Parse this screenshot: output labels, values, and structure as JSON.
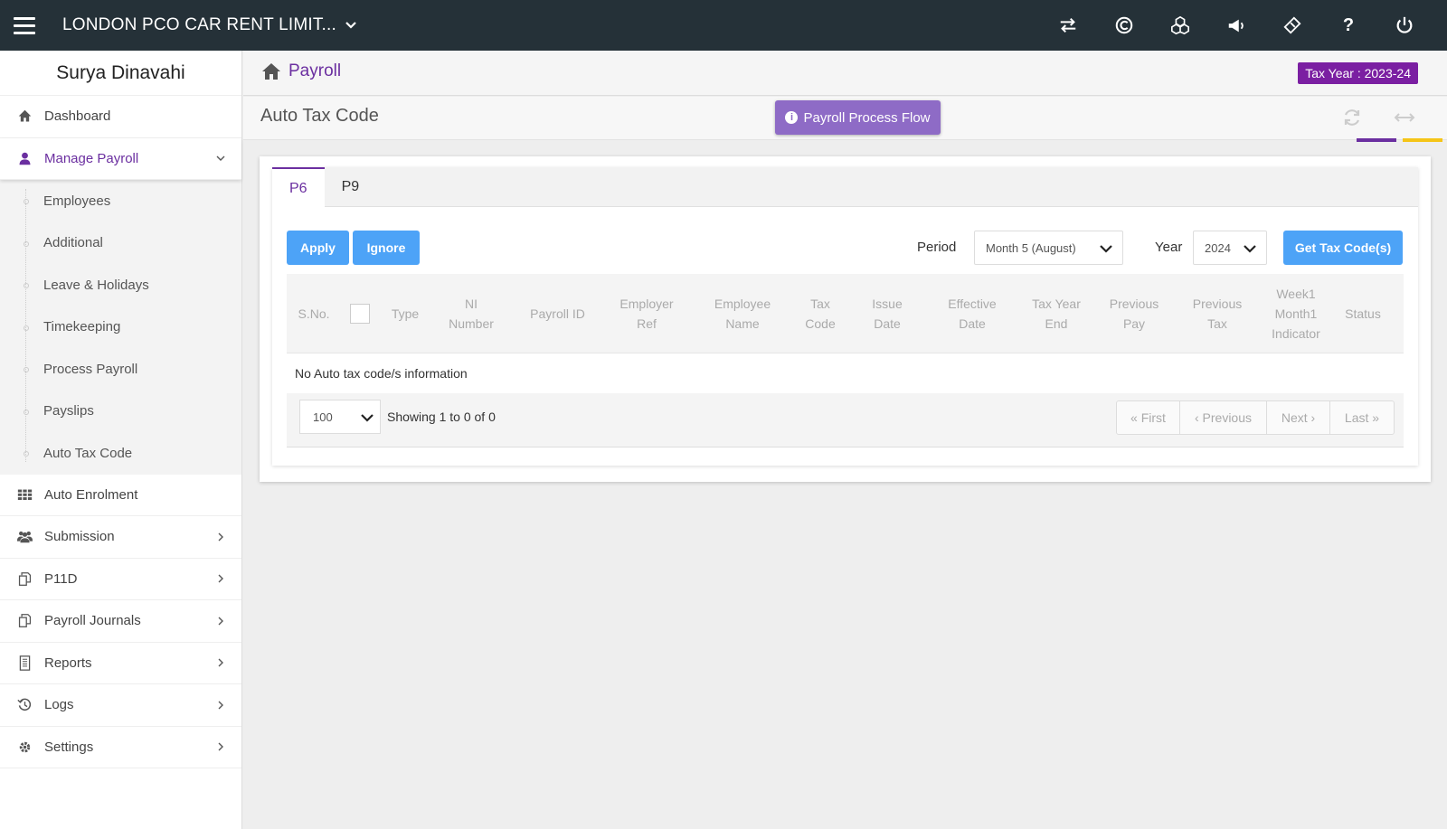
{
  "topbar": {
    "company": "LONDON PCO CAR RENT LIMIT...",
    "help_label": "?"
  },
  "sidebar": {
    "user_name": "Surya Dinavahi",
    "items": [
      {
        "label": "Dashboard",
        "icon": "home-icon"
      },
      {
        "label": "Manage Payroll",
        "icon": "user-icon"
      },
      {
        "label": "Auto Enrolment",
        "icon": "grid-icon"
      },
      {
        "label": "Submission",
        "icon": "users-icon"
      },
      {
        "label": "P11D",
        "icon": "copy-icon"
      },
      {
        "label": "Payroll Journals",
        "icon": "copy-icon"
      },
      {
        "label": "Reports",
        "icon": "document-icon"
      },
      {
        "label": "Logs",
        "icon": "history-icon"
      },
      {
        "label": "Settings",
        "icon": "gear-icon"
      }
    ],
    "submenu": [
      "Employees",
      "Additional",
      "Leave & Holidays",
      "Timekeeping",
      "Process Payroll",
      "Payslips",
      "Auto Tax Code"
    ]
  },
  "header": {
    "breadcrumb": "Payroll",
    "tax_year": "Tax Year : 2023-24"
  },
  "subheader": {
    "title": "Auto Tax Code",
    "flow_button": "Payroll Process Flow"
  },
  "tabs": [
    "P6",
    "P9"
  ],
  "toolbar": {
    "apply": "Apply",
    "ignore": "Ignore",
    "period_label": "Period",
    "period_value": "Month 5 (August)",
    "year_label": "Year",
    "year_value": "2024",
    "get_button": "Get Tax Code(s)"
  },
  "table": {
    "columns": [
      "S.No.",
      "Type",
      "NI\nNumber",
      "Payroll ID",
      "Employer\nRef",
      "Employee\nName",
      "Tax\nCode",
      "Issue\nDate",
      "Effective\nDate",
      "Tax Year\nEnd",
      "Previous\nPay",
      "Previous\nTax",
      "Week1\nMonth1\nIndicator",
      "Status"
    ],
    "empty_message": "No Auto tax code/s information"
  },
  "pager": {
    "page_size": "100",
    "showing": "Showing 1 to 0 of 0",
    "first": "« First",
    "previous": "‹ Previous",
    "next": "Next ›",
    "last": "Last »"
  },
  "colors": {
    "topbar": "#253138",
    "accent_purple": "#6b2fa0",
    "button_blue": "#4da3f7",
    "flow_button": "#8e6bc6",
    "tax_year_badge": "#7b1fa2"
  }
}
